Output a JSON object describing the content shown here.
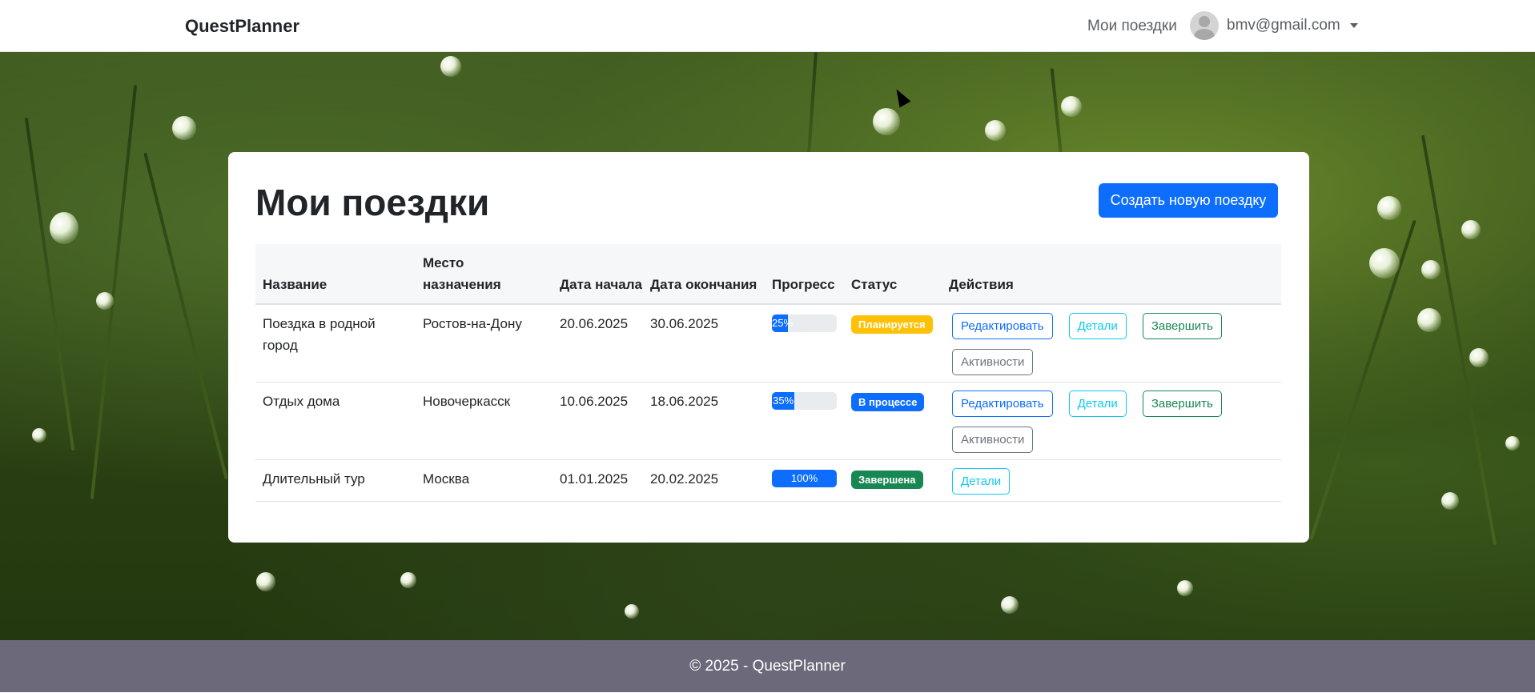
{
  "navbar": {
    "brand": "QuestPlanner",
    "nav_link": "Мои поездки",
    "user_email": "bmv@gmail.com"
  },
  "main": {
    "title": "Мои поездки",
    "create_button": "Создать новую поездку",
    "table": {
      "headers": [
        "Название",
        "Место назначения",
        "Дата начала",
        "Дата окончания",
        "Прогресс",
        "Статус",
        "Действия"
      ],
      "rows": [
        {
          "name": "Поездка в родной город",
          "destination": "Ростов-на-Дону",
          "start": "20.06.2025",
          "end": "30.06.2025",
          "progress_label": "25%",
          "progress": 25,
          "status": "Планируется",
          "actions": [
            "Редактировать",
            "Детали",
            "Завершить",
            "Активности"
          ]
        },
        {
          "name": "Отдых дома",
          "destination": "Новочеркасск",
          "start": "10.06.2025",
          "end": "18.06.2025",
          "progress_label": "35%",
          "progress": 35,
          "status": "В процессе",
          "actions": [
            "Редактировать",
            "Детали",
            "Завершить",
            "Активности"
          ]
        },
        {
          "name": "Длительный тур",
          "destination": "Москва",
          "start": "01.01.2025",
          "end": "20.02.2025",
          "progress_label": "100%",
          "progress": 100,
          "status": "Завершена",
          "actions": [
            "Детали"
          ]
        }
      ]
    }
  },
  "footer": {
    "text": "© 2025 - QuestPlanner"
  },
  "colors": {
    "primary": "#0d6efd",
    "warning": "#ffc107",
    "success": "#198754",
    "info": "#0dcaf0",
    "secondary": "#6c757d",
    "footer_bg": "#6c6a7a"
  }
}
